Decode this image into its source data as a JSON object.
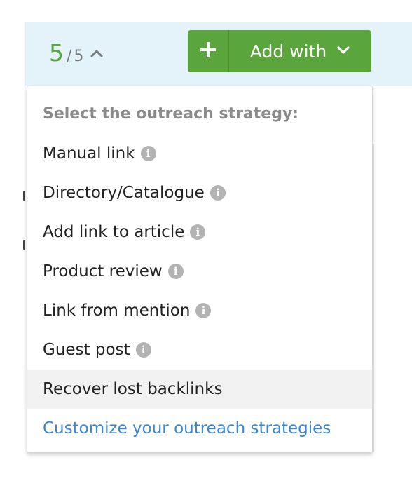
{
  "counter": {
    "current": "5",
    "separator": "/",
    "total": "5",
    "toggle_icon": "chevron-up-icon"
  },
  "toolbar": {
    "plus_icon": "plus-icon",
    "add_with_label": "Add with",
    "add_with_icon": "chevron-down-icon",
    "button_color": "#5ba63c"
  },
  "menu": {
    "header": "Select the outreach strategy:",
    "items": [
      {
        "label": "Manual link",
        "icon": "info-icon"
      },
      {
        "label": "Directory/Catalogue",
        "icon": "info-icon"
      },
      {
        "label": "Add link to article",
        "icon": "info-icon"
      },
      {
        "label": "Product review",
        "icon": "info-icon"
      },
      {
        "label": "Link from mention",
        "icon": "info-icon"
      },
      {
        "label": "Guest post",
        "icon": "info-icon"
      },
      {
        "label": "Recover lost backlinks",
        "highlighted": true
      }
    ],
    "customize_link": "Customize your outreach strategies",
    "link_color": "#3a85d6"
  }
}
